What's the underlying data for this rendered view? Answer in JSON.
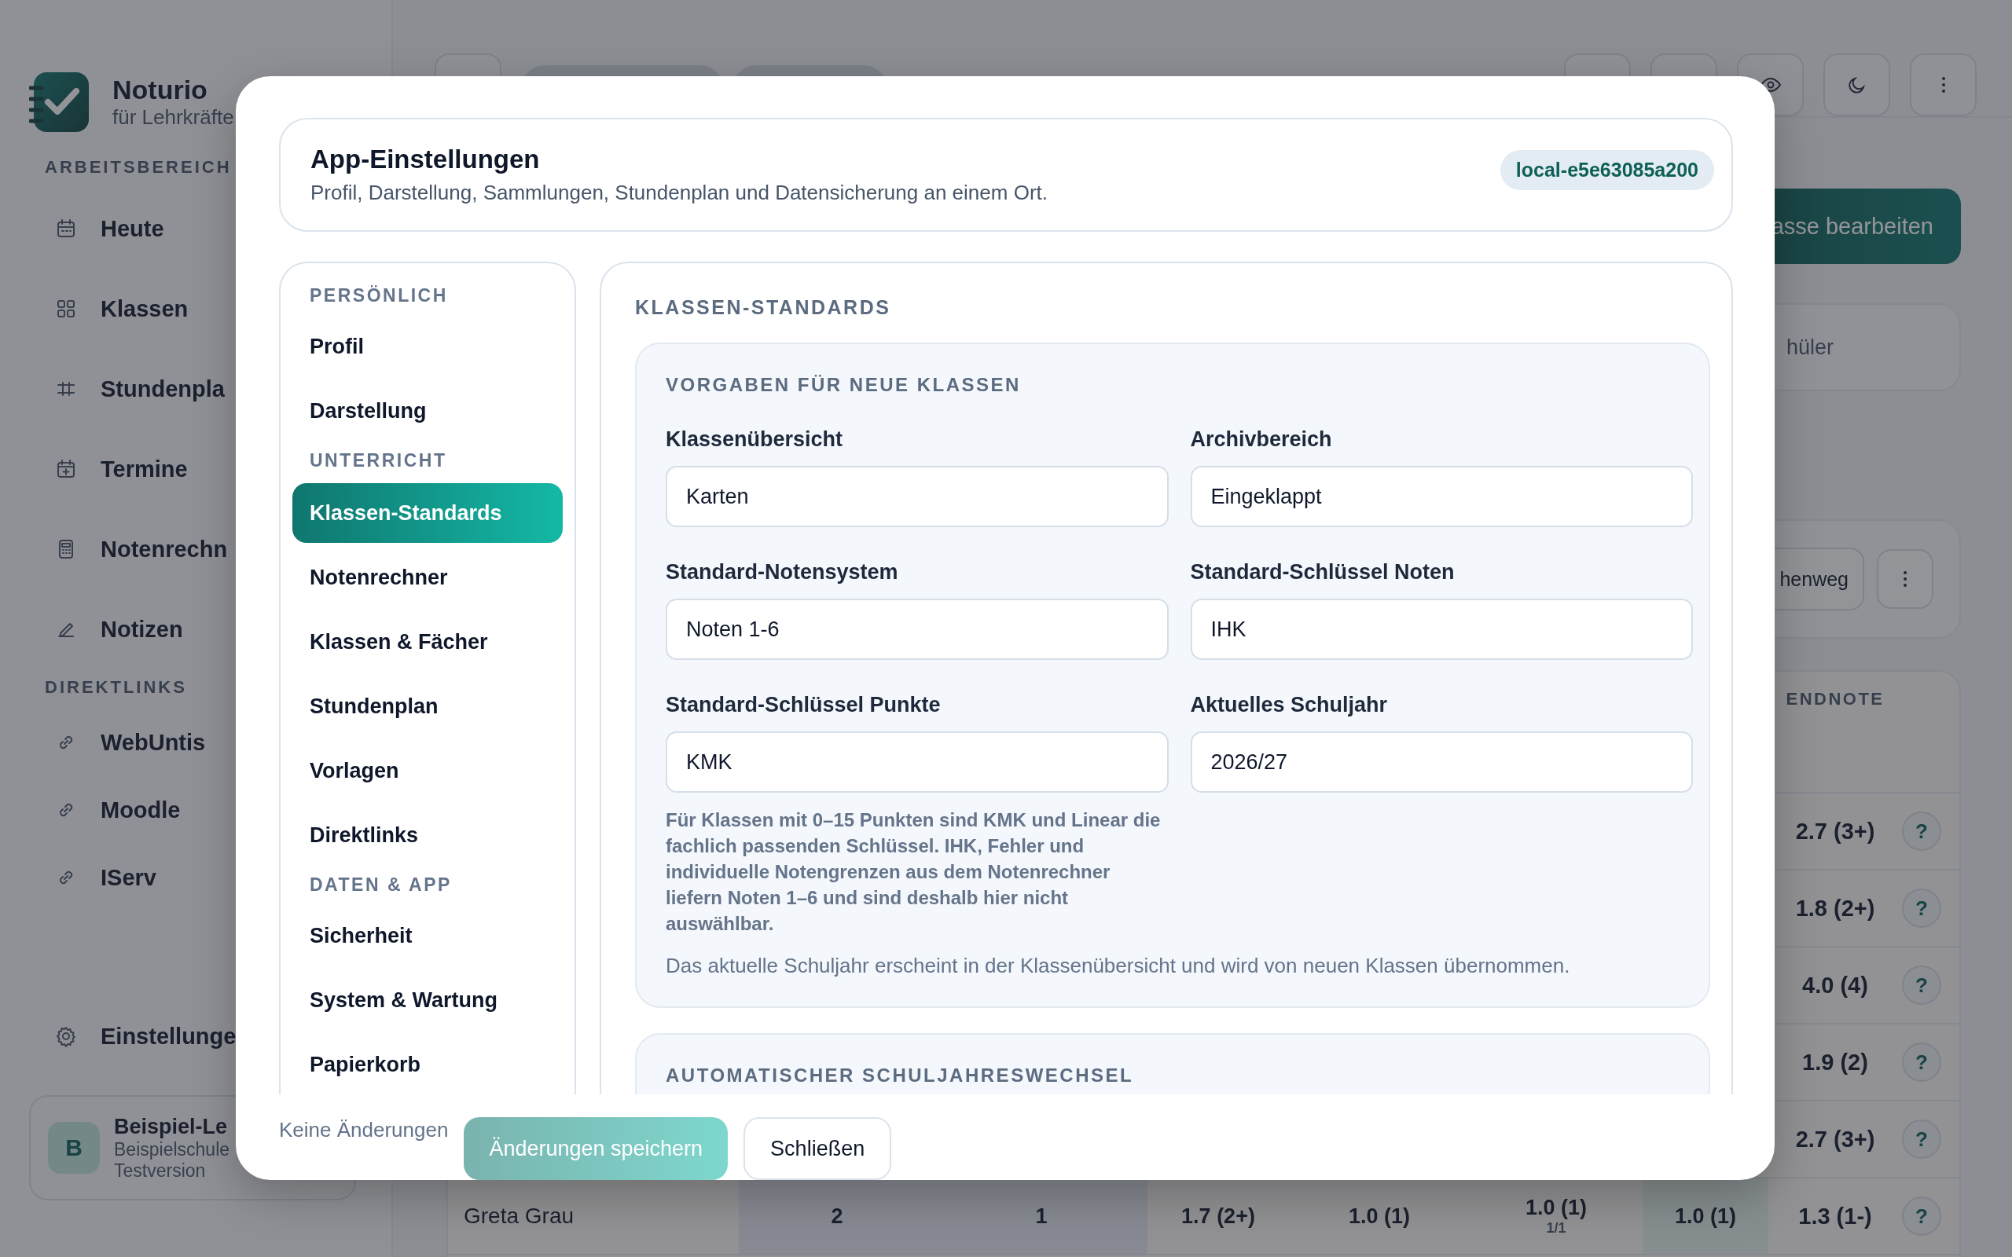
{
  "sidebar": {
    "brand": {
      "name": "Noturio",
      "tagline": "für Lehrkräfte"
    },
    "sections": [
      {
        "title": "ARBEITSBEREICH",
        "items": [
          {
            "label": "Heute"
          },
          {
            "label": "Klassen"
          },
          {
            "label": "Stundenpla"
          },
          {
            "label": "Termine"
          },
          {
            "label": "Notenrechn"
          },
          {
            "label": "Notizen"
          }
        ]
      },
      {
        "title": "DIREKTLINKS",
        "items": [
          {
            "label": "WebUntis"
          },
          {
            "label": "Moodle"
          },
          {
            "label": "IServ"
          }
        ]
      }
    ],
    "settings": "Einstellunge",
    "profile": {
      "initial": "B",
      "name": "Beispiel-Le",
      "school": "Beispielschule",
      "plan": "Testversion"
    }
  },
  "main": {
    "edit_button": "asse bearbeiten",
    "search_text": "hüler",
    "action_button": "henweg",
    "table": {
      "header": "ENDNOTE",
      "rows": [
        {
          "endnote": "2.7 (3+)",
          "help": "?"
        },
        {
          "endnote": "1.8 (2+)",
          "help": "?"
        },
        {
          "endnote": "4.0 (4)",
          "help": "?"
        },
        {
          "endnote": "1.9 (2)",
          "help": "?"
        },
        {
          "endnote": "2.7 (3+)",
          "help": "?"
        },
        {
          "name": "Greta Grau",
          "values": [
            {
              "text": "2"
            },
            {
              "text": "1"
            },
            {
              "text": "1.7 (2+)"
            },
            {
              "text": "1.0 (1)"
            },
            {
              "text": "1.0 (1)",
              "sub": "1/1"
            },
            {
              "text": "1.0 (1)"
            }
          ],
          "endnote": "1.3 (1-)",
          "help": "?"
        }
      ]
    }
  },
  "modal": {
    "title": "App-Einstellungen",
    "subtitle": "Profil, Darstellung, Sammlungen, Stundenplan und Datensicherung an einem Ort.",
    "badge": "local-e5e63085a200",
    "nav": [
      {
        "title": "PERSÖNLICH",
        "items": [
          {
            "label": "Profil",
            "selected": false
          },
          {
            "label": "Darstellung",
            "selected": false
          }
        ]
      },
      {
        "title": "UNTERRICHT",
        "items": [
          {
            "label": "Klassen-Standards",
            "selected": true
          },
          {
            "label": "Notenrechner",
            "selected": false
          },
          {
            "label": "Klassen & Fächer",
            "selected": false
          },
          {
            "label": "Stundenplan",
            "selected": false
          },
          {
            "label": "Vorlagen",
            "selected": false
          },
          {
            "label": "Direktlinks",
            "selected": false
          }
        ]
      },
      {
        "title": "DATEN & APP",
        "items": [
          {
            "label": "Sicherheit",
            "selected": false
          },
          {
            "label": "System & Wartung",
            "selected": false
          },
          {
            "label": "Papierkorb",
            "selected": false
          }
        ]
      }
    ],
    "content": {
      "heading": "KLASSEN-STANDARDS",
      "panels": [
        {
          "heading": "VORGABEN FÜR NEUE KLASSEN",
          "fields": [
            {
              "label": "Klassenübersicht",
              "value": "Karten"
            },
            {
              "label": "Archivbereich",
              "value": "Eingeklappt"
            },
            {
              "label": "Standard-Notensystem",
              "value": "Noten 1-6"
            },
            {
              "label": "Standard-Schlüssel Noten",
              "value": "IHK"
            },
            {
              "label": "Standard-Schlüssel Punkte",
              "value": "KMK"
            },
            {
              "label": "Aktuelles Schuljahr",
              "value": "2026/27"
            }
          ],
          "hint": "Für Klassen mit 0–15 Punkten sind KMK und Linear die fachlich passenden Schlüssel. IHK, Fehler und individuelle Notengrenzen aus dem Notenrechner liefern Noten 1–6 und sind deshalb hier nicht auswählbar.",
          "note": "Das aktuelle Schuljahr erscheint in der Klassenübersicht und wird von neuen Klassen übernommen."
        },
        {
          "heading": "AUTOMATISCHER SCHULJAHRESWECHSEL"
        }
      ]
    },
    "footer": {
      "status": "Keine Änderungen",
      "save": {
        "label": "Änderungen speichern",
        "disabled": true
      },
      "close": "Schließen"
    }
  }
}
